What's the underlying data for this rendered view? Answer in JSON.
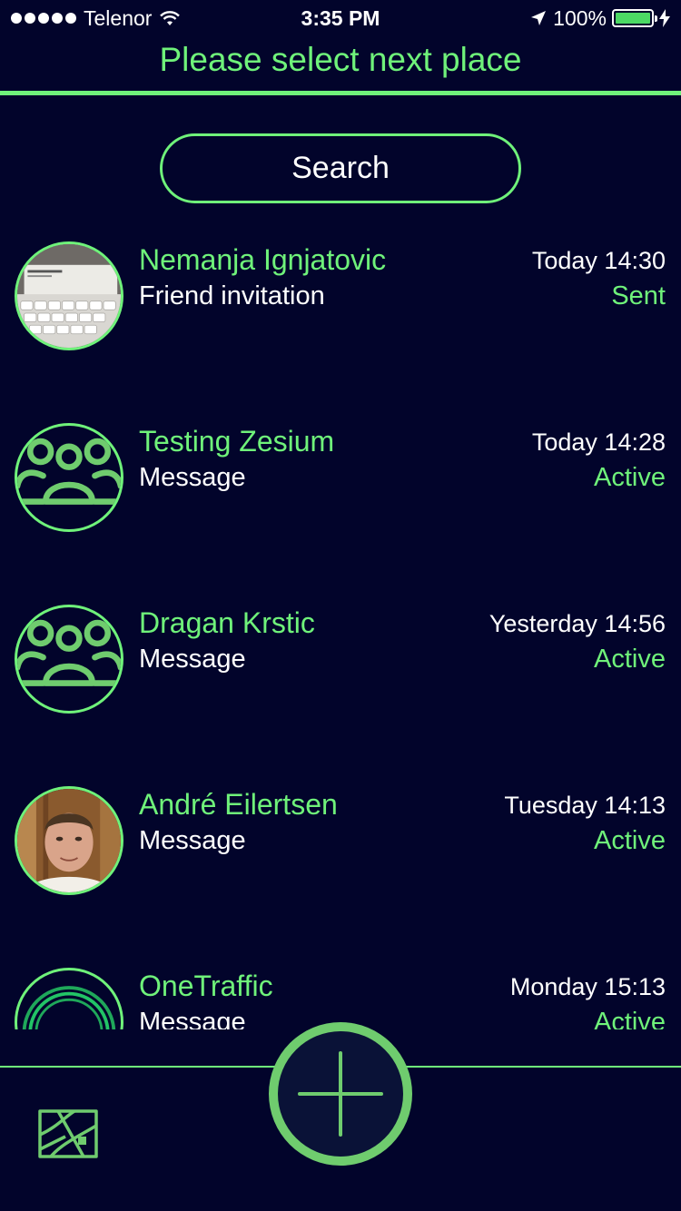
{
  "status_bar": {
    "carrier": "Telenor",
    "time": "3:35 PM",
    "battery": "100%",
    "battery_level": 1.0
  },
  "header": {
    "title": "Please select next place"
  },
  "search": {
    "label": "Search"
  },
  "items": [
    {
      "name": "Nemanja Ignjatovic",
      "subtitle": "Friend invitation",
      "time": "Today 14:30",
      "status": "Sent",
      "avatar": "photo-screenshot"
    },
    {
      "name": "Testing Zesium",
      "subtitle": "Message",
      "time": "Today 14:28",
      "status": "Active",
      "avatar": "group-icon"
    },
    {
      "name": "Dragan Krstic",
      "subtitle": "Message",
      "time": "Yesterday 14:56",
      "status": "Active",
      "avatar": "group-icon"
    },
    {
      "name": "André Eilertsen",
      "subtitle": "Message",
      "time": "Tuesday 14:13",
      "status": "Active",
      "avatar": "photo-person"
    },
    {
      "name": "OneTraffic",
      "subtitle": "Message",
      "time": "Monday 15:13",
      "status": "Active",
      "avatar": "ring-logo"
    }
  ],
  "colors": {
    "background": "#02042b",
    "accent": "#6ff27a",
    "button_ring": "#6fcc6e",
    "text": "#ffffff"
  },
  "bottom_bar": {
    "left_icon": "map-icon",
    "center_icon": "plus-icon"
  }
}
